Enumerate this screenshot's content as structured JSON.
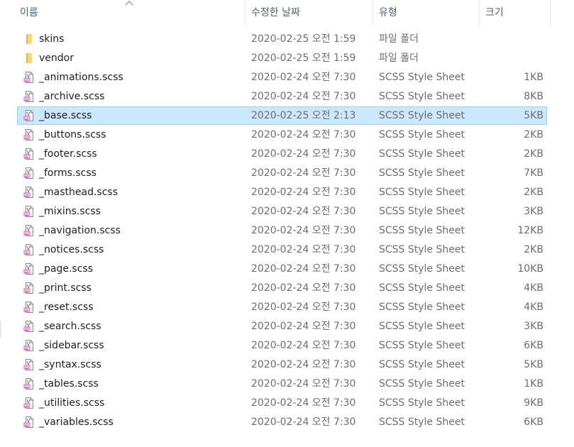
{
  "header": {
    "name": "이름",
    "date": "수정한 날짜",
    "type": "유형",
    "size": "크기"
  },
  "icons": {
    "folder": "folder-icon",
    "file": "scss-file-icon",
    "sort": "sort-ascending-icon"
  },
  "colors": {
    "selection_bg": "#cce8ff",
    "selection_border": "#99d1ff",
    "folder": "#f8d775",
    "header_text": "#4c607a"
  },
  "files": [
    {
      "name": "skins",
      "date": "2020-02-25 오전 1:59",
      "type": "파일 폴더",
      "size": "",
      "kind": "folder"
    },
    {
      "name": "vendor",
      "date": "2020-02-25 오전 1:59",
      "type": "파일 폴더",
      "size": "",
      "kind": "folder"
    },
    {
      "name": "_animations.scss",
      "date": "2020-02-24 오전 7:30",
      "type": "SCSS Style Sheet",
      "size": "1KB",
      "kind": "file"
    },
    {
      "name": "_archive.scss",
      "date": "2020-02-24 오전 7:30",
      "type": "SCSS Style Sheet",
      "size": "8KB",
      "kind": "file"
    },
    {
      "name": "_base.scss",
      "date": "2020-02-25 오전 2:13",
      "type": "SCSS Style Sheet",
      "size": "5KB",
      "kind": "file",
      "selected": true
    },
    {
      "name": "_buttons.scss",
      "date": "2020-02-24 오전 7:30",
      "type": "SCSS Style Sheet",
      "size": "2KB",
      "kind": "file"
    },
    {
      "name": "_footer.scss",
      "date": "2020-02-24 오전 7:30",
      "type": "SCSS Style Sheet",
      "size": "2KB",
      "kind": "file"
    },
    {
      "name": "_forms.scss",
      "date": "2020-02-24 오전 7:30",
      "type": "SCSS Style Sheet",
      "size": "7KB",
      "kind": "file"
    },
    {
      "name": "_masthead.scss",
      "date": "2020-02-24 오전 7:30",
      "type": "SCSS Style Sheet",
      "size": "2KB",
      "kind": "file"
    },
    {
      "name": "_mixins.scss",
      "date": "2020-02-24 오전 7:30",
      "type": "SCSS Style Sheet",
      "size": "3KB",
      "kind": "file"
    },
    {
      "name": "_navigation.scss",
      "date": "2020-02-24 오전 7:30",
      "type": "SCSS Style Sheet",
      "size": "12KB",
      "kind": "file"
    },
    {
      "name": "_notices.scss",
      "date": "2020-02-24 오전 7:30",
      "type": "SCSS Style Sheet",
      "size": "2KB",
      "kind": "file"
    },
    {
      "name": "_page.scss",
      "date": "2020-02-24 오전 7:30",
      "type": "SCSS Style Sheet",
      "size": "10KB",
      "kind": "file"
    },
    {
      "name": "_print.scss",
      "date": "2020-02-24 오전 7:30",
      "type": "SCSS Style Sheet",
      "size": "4KB",
      "kind": "file"
    },
    {
      "name": "_reset.scss",
      "date": "2020-02-24 오전 7:30",
      "type": "SCSS Style Sheet",
      "size": "4KB",
      "kind": "file"
    },
    {
      "name": "_search.scss",
      "date": "2020-02-24 오전 7:30",
      "type": "SCSS Style Sheet",
      "size": "3KB",
      "kind": "file"
    },
    {
      "name": "_sidebar.scss",
      "date": "2020-02-24 오전 7:30",
      "type": "SCSS Style Sheet",
      "size": "6KB",
      "kind": "file"
    },
    {
      "name": "_syntax.scss",
      "date": "2020-02-24 오전 7:30",
      "type": "SCSS Style Sheet",
      "size": "5KB",
      "kind": "file"
    },
    {
      "name": "_tables.scss",
      "date": "2020-02-24 오전 7:30",
      "type": "SCSS Style Sheet",
      "size": "1KB",
      "kind": "file"
    },
    {
      "name": "_utilities.scss",
      "date": "2020-02-24 오전 7:30",
      "type": "SCSS Style Sheet",
      "size": "9KB",
      "kind": "file"
    },
    {
      "name": "_variables.scss",
      "date": "2020-02-24 오전 7:30",
      "type": "SCSS Style Sheet",
      "size": "6KB",
      "kind": "file"
    }
  ]
}
